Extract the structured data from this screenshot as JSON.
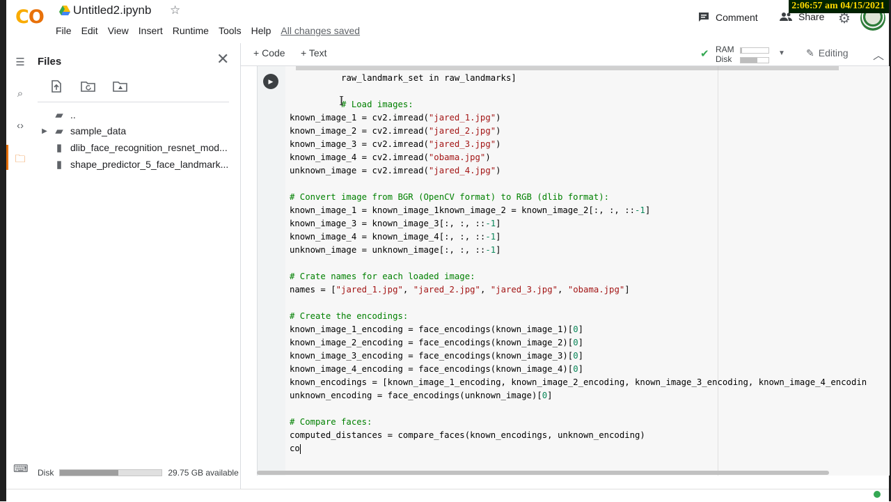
{
  "app": {
    "title": "Untitled2.ipynb",
    "logo_text": "CO",
    "accent_color": "#e8710a",
    "logo_color": "#f9ab00"
  },
  "menu": [
    "File",
    "Edit",
    "View",
    "Insert",
    "Runtime",
    "Tools",
    "Help"
  ],
  "save_status": "All changes saved",
  "header_actions": {
    "comment": "Comment",
    "share": "Share"
  },
  "clock": "2:06:57 am 04/15/2021",
  "files_panel": {
    "title": "Files",
    "items": [
      {
        "name": "..",
        "icon": "folder-up-icon",
        "expandable": false
      },
      {
        "name": "sample_data",
        "icon": "folder-icon",
        "expandable": true
      },
      {
        "name": "dlib_face_recognition_resnet_mod...",
        "icon": "file-icon",
        "expandable": false
      },
      {
        "name": "shape_predictor_5_face_landmark...",
        "icon": "file-icon",
        "expandable": false
      }
    ],
    "disk_label": "Disk",
    "disk_available": "29.75 GB available",
    "disk_used_fraction": 0.57
  },
  "toolbar": {
    "add_code": "Code",
    "add_text": "Text",
    "ram_label": "RAM",
    "disk_label": "Disk",
    "ram_fraction": 0.05,
    "disk_fraction": 0.6,
    "editing": "Editing"
  },
  "code_lines": [
    {
      "indent": "          ",
      "parts": [
        {
          "t": "raw_landmark_set in raw_landmarks]",
          "c": ""
        }
      ]
    },
    {
      "indent": "",
      "parts": []
    },
    {
      "indent": "          ",
      "parts": [
        {
          "t": "# Load images:",
          "c": "comment"
        }
      ]
    },
    {
      "indent": "",
      "parts": [
        {
          "t": "known_image_1 = cv2.imread(",
          "c": ""
        },
        {
          "t": "\"jared_1.jpg\"",
          "c": "str"
        },
        {
          "t": ")",
          "c": ""
        }
      ]
    },
    {
      "indent": "",
      "parts": [
        {
          "t": "known_image_2 = cv2.imread(",
          "c": ""
        },
        {
          "t": "\"jared_2.jpg\"",
          "c": "str"
        },
        {
          "t": ")",
          "c": ""
        }
      ]
    },
    {
      "indent": "",
      "parts": [
        {
          "t": "known_image_3 = cv2.imread(",
          "c": ""
        },
        {
          "t": "\"jared_3.jpg\"",
          "c": "str"
        },
        {
          "t": ")",
          "c": ""
        }
      ]
    },
    {
      "indent": "",
      "parts": [
        {
          "t": "known_image_4 = cv2.imread(",
          "c": ""
        },
        {
          "t": "\"obama.jpg\"",
          "c": "str"
        },
        {
          "t": ")",
          "c": ""
        }
      ]
    },
    {
      "indent": "",
      "parts": [
        {
          "t": "unknown_image = cv2.imread(",
          "c": ""
        },
        {
          "t": "\"jared_4.jpg\"",
          "c": "str"
        },
        {
          "t": ")",
          "c": ""
        }
      ]
    },
    {
      "indent": "",
      "parts": []
    },
    {
      "indent": "",
      "parts": [
        {
          "t": "# Convert image from BGR (OpenCV format) to RGB (dlib format):",
          "c": "comment"
        }
      ]
    },
    {
      "indent": "",
      "parts": [
        {
          "t": "known_image_1 = known_image_1known_image_2 = known_image_2[:, :, ::",
          "c": ""
        },
        {
          "t": "-1",
          "c": "num"
        },
        {
          "t": "]",
          "c": ""
        }
      ]
    },
    {
      "indent": "",
      "parts": [
        {
          "t": "known_image_3 = known_image_3[:, :, ::",
          "c": ""
        },
        {
          "t": "-1",
          "c": "num"
        },
        {
          "t": "]",
          "c": ""
        }
      ]
    },
    {
      "indent": "",
      "parts": [
        {
          "t": "known_image_4 = known_image_4[:, :, ::",
          "c": ""
        },
        {
          "t": "-1",
          "c": "num"
        },
        {
          "t": "]",
          "c": ""
        }
      ]
    },
    {
      "indent": "",
      "parts": [
        {
          "t": "unknown_image = unknown_image[:, :, ::",
          "c": ""
        },
        {
          "t": "-1",
          "c": "num"
        },
        {
          "t": "]",
          "c": ""
        }
      ]
    },
    {
      "indent": "",
      "parts": []
    },
    {
      "indent": "",
      "parts": [
        {
          "t": "# Crate names for each loaded image:",
          "c": "comment"
        }
      ]
    },
    {
      "indent": "",
      "parts": [
        {
          "t": "names = [",
          "c": ""
        },
        {
          "t": "\"jared_1.jpg\"",
          "c": "str"
        },
        {
          "t": ", ",
          "c": ""
        },
        {
          "t": "\"jared_2.jpg\"",
          "c": "str"
        },
        {
          "t": ", ",
          "c": ""
        },
        {
          "t": "\"jared_3.jpg\"",
          "c": "str"
        },
        {
          "t": ", ",
          "c": ""
        },
        {
          "t": "\"obama.jpg\"",
          "c": "str"
        },
        {
          "t": "]",
          "c": ""
        }
      ]
    },
    {
      "indent": "",
      "parts": []
    },
    {
      "indent": "",
      "parts": [
        {
          "t": "# Create the encodings:",
          "c": "comment"
        }
      ]
    },
    {
      "indent": "",
      "parts": [
        {
          "t": "known_image_1_encoding = face_encodings(known_image_1)[",
          "c": ""
        },
        {
          "t": "0",
          "c": "num"
        },
        {
          "t": "]",
          "c": ""
        }
      ]
    },
    {
      "indent": "",
      "parts": [
        {
          "t": "known_image_2_encoding = face_encodings(known_image_2)[",
          "c": ""
        },
        {
          "t": "0",
          "c": "num"
        },
        {
          "t": "]",
          "c": ""
        }
      ]
    },
    {
      "indent": "",
      "parts": [
        {
          "t": "known_image_3_encoding = face_encodings(known_image_3)[",
          "c": ""
        },
        {
          "t": "0",
          "c": "num"
        },
        {
          "t": "]",
          "c": ""
        }
      ]
    },
    {
      "indent": "",
      "parts": [
        {
          "t": "known_image_4_encoding = face_encodings(known_image_4)[",
          "c": ""
        },
        {
          "t": "0",
          "c": "num"
        },
        {
          "t": "]",
          "c": ""
        }
      ]
    },
    {
      "indent": "",
      "parts": [
        {
          "t": "known_encodings = [known_image_1_encoding, known_image_2_encoding, known_image_3_encoding, known_image_4_encodin",
          "c": ""
        }
      ]
    },
    {
      "indent": "",
      "parts": [
        {
          "t": "unknown_encoding = face_encodings(unknown_image)[",
          "c": ""
        },
        {
          "t": "0",
          "c": "num"
        },
        {
          "t": "]",
          "c": ""
        }
      ]
    },
    {
      "indent": "",
      "parts": []
    },
    {
      "indent": "",
      "parts": [
        {
          "t": "# Compare faces:",
          "c": "comment"
        }
      ]
    },
    {
      "indent": "",
      "parts": [
        {
          "t": "computed_distances = compare_faces(known_encodings, unknown_encoding)",
          "c": ""
        }
      ]
    },
    {
      "indent": "",
      "parts": [
        {
          "t": "co",
          "c": ""
        }
      ],
      "cursor": true
    }
  ]
}
